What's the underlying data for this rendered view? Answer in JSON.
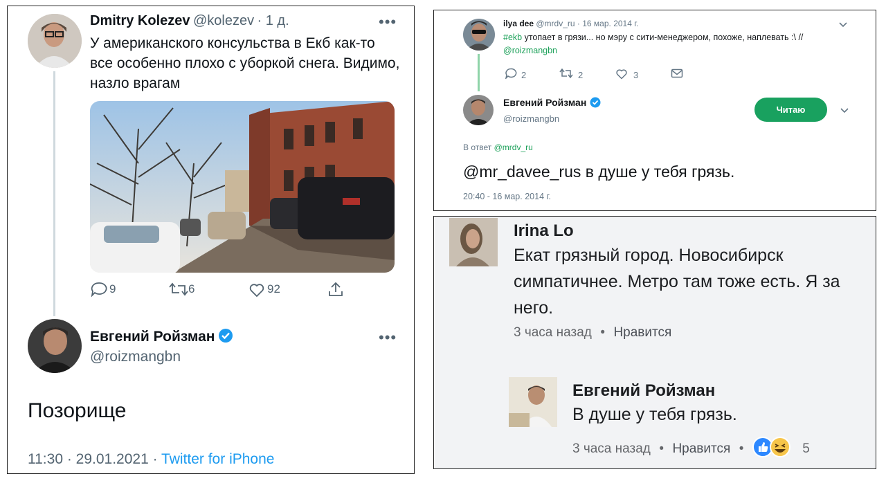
{
  "left_tweet": {
    "author_name": "Dmitry Kolezev",
    "author_handle": "@kolezev",
    "time_ago": "· 1 д.",
    "text": "У американского консульства в Екб как-то все особенно плохо с уборкой снега. Видимо, назло врагам",
    "actions": {
      "replies": "9",
      "retweets": "6",
      "likes": "92"
    },
    "reply": {
      "author_name": "Евгений Ройзман",
      "author_handle": "@roizmangbn",
      "text": "Позорище",
      "timestamp": "11:30 · 29.01.2021 · ",
      "source": "Twitter for iPhone"
    }
  },
  "top_right": {
    "tweet": {
      "author_name": "ilya dee",
      "author_handle": "@mrdv_ru",
      "date": "· 16 мар. 2014 г.",
      "hashtag": "#ekb",
      "text": " утопает в грязи... но мэру с сити-менеджером, похоже, наплевать :\\ //",
      "mention": "@roizmangbn",
      "actions": {
        "replies": "2",
        "retweets": "2",
        "likes": "3"
      }
    },
    "reply": {
      "author_name": "Евгений Ройзман",
      "author_handle": "@roizmangbn",
      "follow_label": "Читаю",
      "in_reply_prefix": "В ответ ",
      "in_reply_to": "@mrdv_ru",
      "text": "@mr_davee_rus в душе у тебя грязь.",
      "timestamp": "20:40 - 16 мар. 2014 г."
    }
  },
  "bottom_right": {
    "comment": {
      "author_name": "Irina Lo",
      "text": "Екат грязный город. Новосибирск симпатичнее. Метро там тоже есть. Я за него.",
      "time": "3 часа назад",
      "like_label": "Нравится"
    },
    "reply": {
      "author_name": "Евгений Ройзман",
      "text": "В душе у тебя грязь.",
      "time": "3 часа назад",
      "like_label": "Нравится",
      "reactions_count": "5"
    }
  },
  "colors": {
    "twitter_blue": "#1d9bf0",
    "follow_green": "#19a15f",
    "verified_blue": "#1d9bf0"
  }
}
